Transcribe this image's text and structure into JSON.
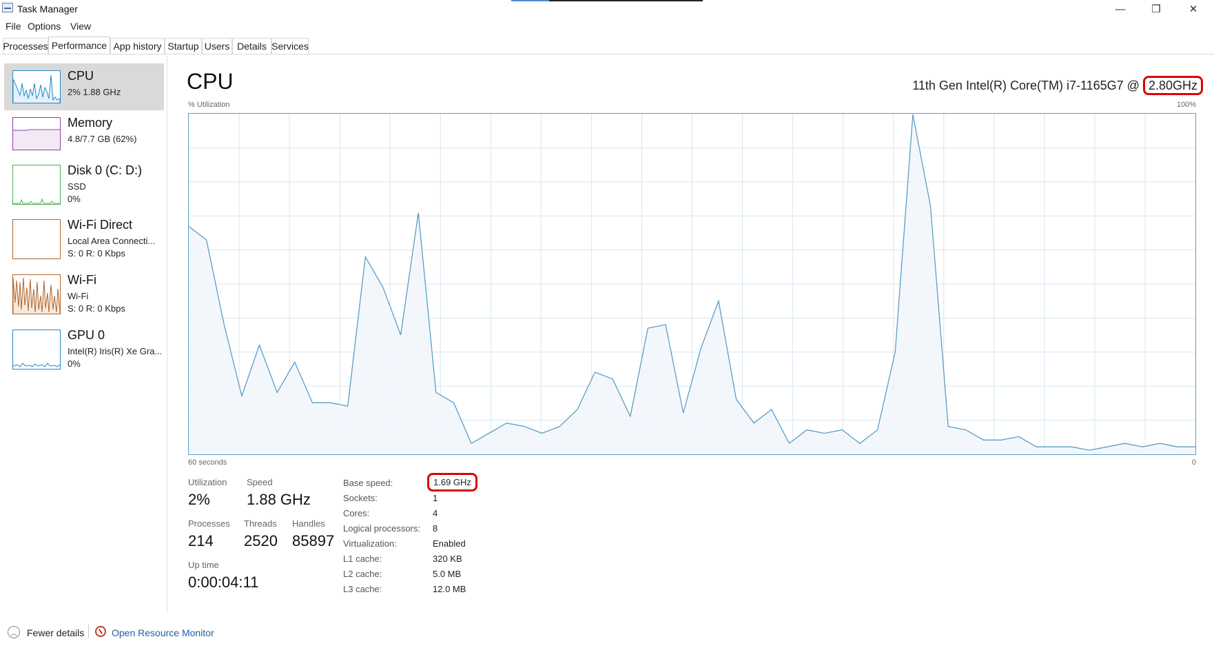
{
  "window": {
    "title": "Task Manager",
    "controls": [
      "—",
      "❐",
      "✕"
    ]
  },
  "menu": [
    "File",
    "Options",
    "View"
  ],
  "tabs": [
    "Processes",
    "Performance",
    "App history",
    "Startup",
    "Users",
    "Details",
    "Services"
  ],
  "active_tab": "Performance",
  "sidebar": [
    {
      "name": "CPU",
      "sub1": "2%  1.88 GHz",
      "sub2": "",
      "sub3": "",
      "color": "#1f88c9"
    },
    {
      "name": "Memory",
      "sub1": "4.8/7.7 GB (62%)",
      "sub2": "",
      "sub3": "",
      "color": "#8b3fa6"
    },
    {
      "name": "Disk 0 (C: D:)",
      "sub1": "SSD",
      "sub2": "0%",
      "sub3": "",
      "color": "#4caf50"
    },
    {
      "name": "Wi-Fi Direct",
      "sub1": "Local Area Connecti...",
      "sub2": "S: 0  R: 0 Kbps",
      "sub3": "",
      "color": "#b0652a"
    },
    {
      "name": "Wi-Fi",
      "sub1": "Wi-Fi",
      "sub2": "S: 0  R: 0 Kbps",
      "sub3": "",
      "color": "#b0652a"
    },
    {
      "name": "GPU 0",
      "sub1": "Intel(R) Iris(R) Xe Gra...",
      "sub2": "0%",
      "sub3": "",
      "color": "#1f88c9"
    }
  ],
  "main": {
    "title": "CPU",
    "model": "11th Gen Intel(R) Core(TM) i7-1165G7 @ 2.80GHz",
    "model_prefix": "11th Gen Intel(R) Core(TM) i7-1165G7 @ ",
    "model_speed": "2.80GHz",
    "graph_label": "% Utilization",
    "graph_max": "100%",
    "graph_time": "60 seconds",
    "graph_min": "0",
    "stats": {
      "utilization_label": "Utilization",
      "utilization": "2%",
      "speed_label": "Speed",
      "speed": "1.88 GHz",
      "processes_label": "Processes",
      "processes": "214",
      "threads_label": "Threads",
      "threads": "2520",
      "handles_label": "Handles",
      "handles": "85897",
      "uptime_label": "Up time",
      "uptime": "0:00:04:11"
    },
    "specs": [
      {
        "k": "Base speed:",
        "v": "1.69 GHz"
      },
      {
        "k": "Sockets:",
        "v": "1"
      },
      {
        "k": "Cores:",
        "v": "4"
      },
      {
        "k": "Logical processors:",
        "v": "8"
      },
      {
        "k": "Virtualization:",
        "v": "Enabled"
      },
      {
        "k": "L1 cache:",
        "v": "320 KB"
      },
      {
        "k": "L2 cache:",
        "v": "5.0 MB"
      },
      {
        "k": "L3 cache:",
        "v": "12.0 MB"
      }
    ]
  },
  "footer": {
    "fewer_details": "Fewer details",
    "open_resource_monitor": "Open Resource Monitor"
  },
  "colors": {
    "graph_line": "#5a9dc6",
    "graph_fill": "#f1f6fb",
    "grid": "#d6e6f1",
    "highlight": "#d00000"
  },
  "chart_data": {
    "type": "area",
    "ylim": [
      0,
      100
    ],
    "values": [
      67,
      63,
      38,
      17,
      32,
      18,
      27,
      15,
      15,
      14,
      58,
      49,
      35,
      71,
      18,
      15,
      3,
      6,
      9,
      8,
      6,
      8,
      13,
      24,
      22,
      11,
      37,
      38,
      12,
      31,
      45,
      16,
      9,
      13,
      3,
      7,
      6,
      7,
      3,
      7,
      30,
      100,
      73,
      8,
      7,
      4,
      4,
      5,
      2,
      2,
      2,
      1,
      2,
      3,
      2,
      3,
      2,
      2
    ]
  }
}
